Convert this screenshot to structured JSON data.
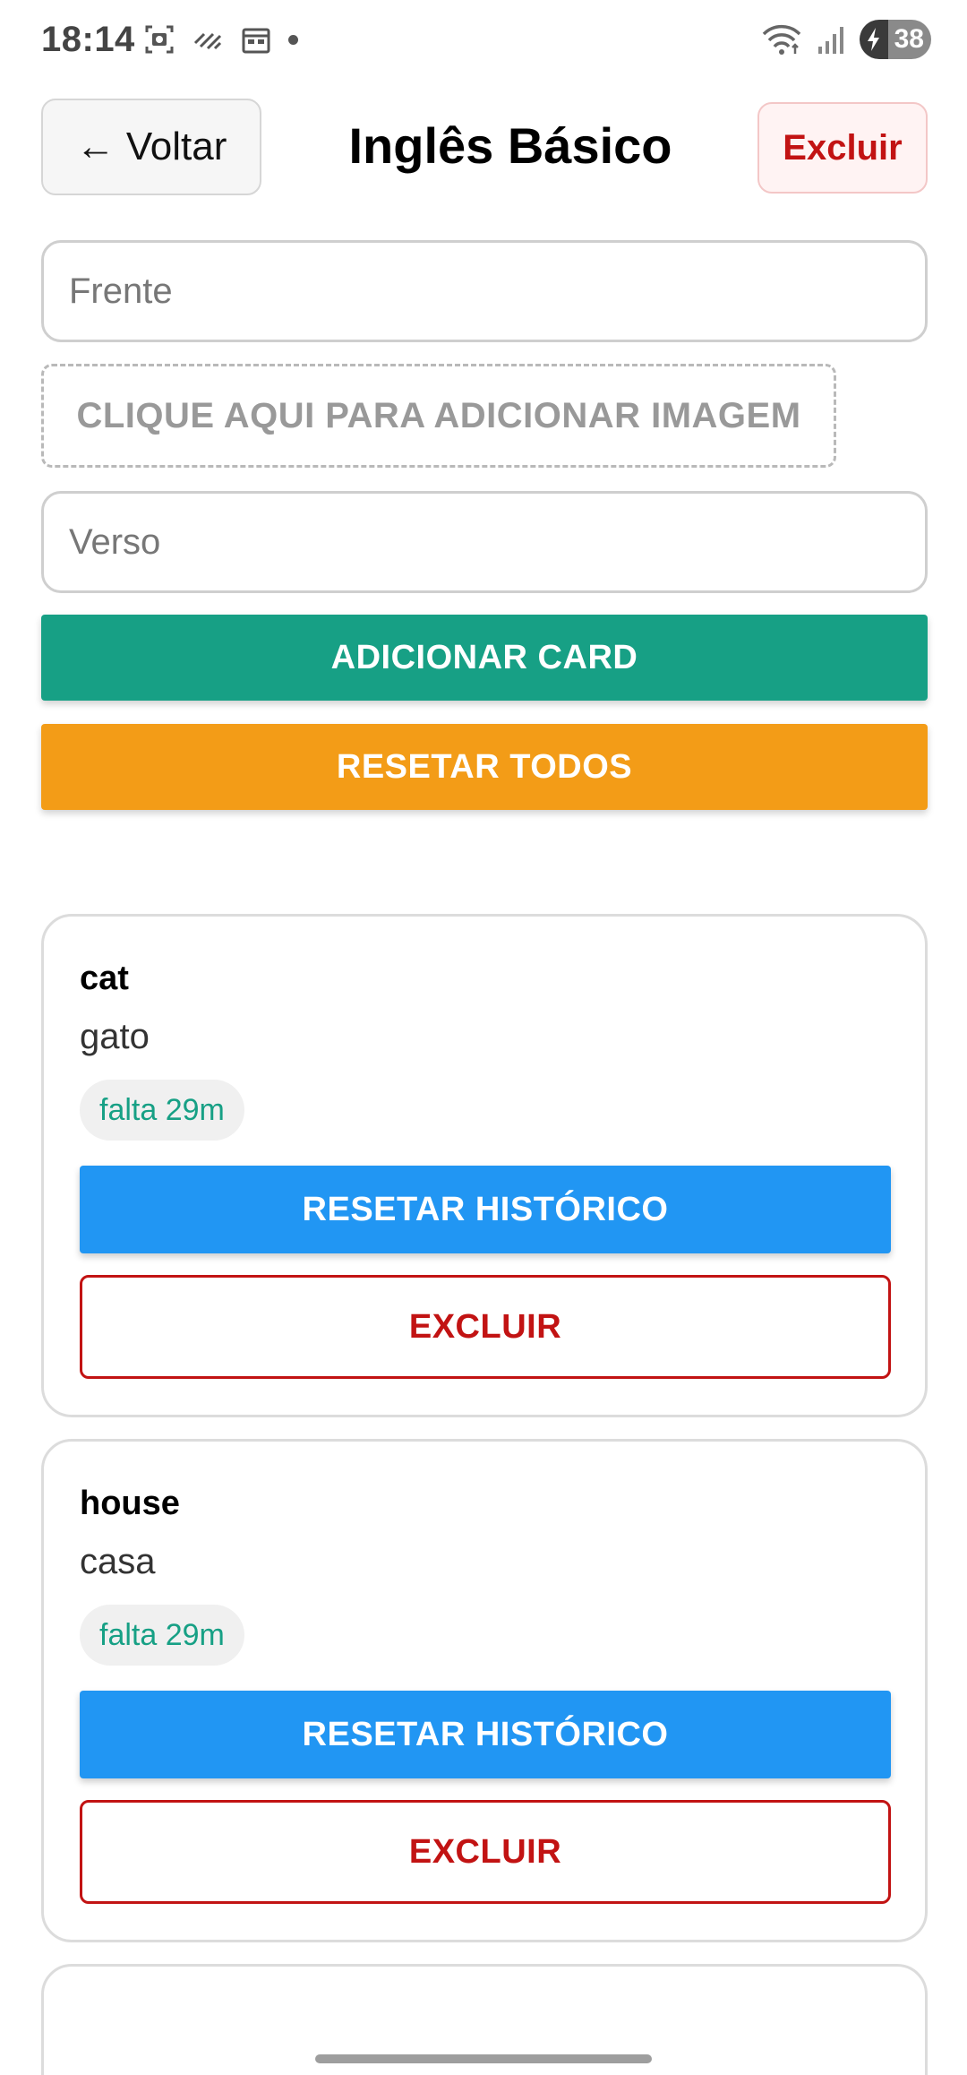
{
  "status_bar": {
    "time": "18:14",
    "battery": "38"
  },
  "header": {
    "back_label": "← Voltar",
    "title": "Inglês Básico",
    "delete_label": "Excluir"
  },
  "form": {
    "front_placeholder": "Frente",
    "image_label": "CLIQUE AQUI PARA ADICIONAR IMAGEM",
    "back_placeholder": "Verso",
    "add_card_label": "ADICIONAR CARD",
    "reset_all_label": "RESETAR TODOS"
  },
  "colors": {
    "primary": "#17a085",
    "warning": "#f39c17",
    "info": "#2196f3",
    "danger": "#c21313"
  },
  "cards": [
    {
      "front": "cat",
      "back": "gato",
      "due": "falta 29m",
      "reset_label": "RESETAR HISTÓRICO",
      "delete_label": "EXCLUIR"
    },
    {
      "front": "house",
      "back": "casa",
      "due": "falta 29m",
      "reset_label": "RESETAR HISTÓRICO",
      "delete_label": "EXCLUIR"
    }
  ]
}
